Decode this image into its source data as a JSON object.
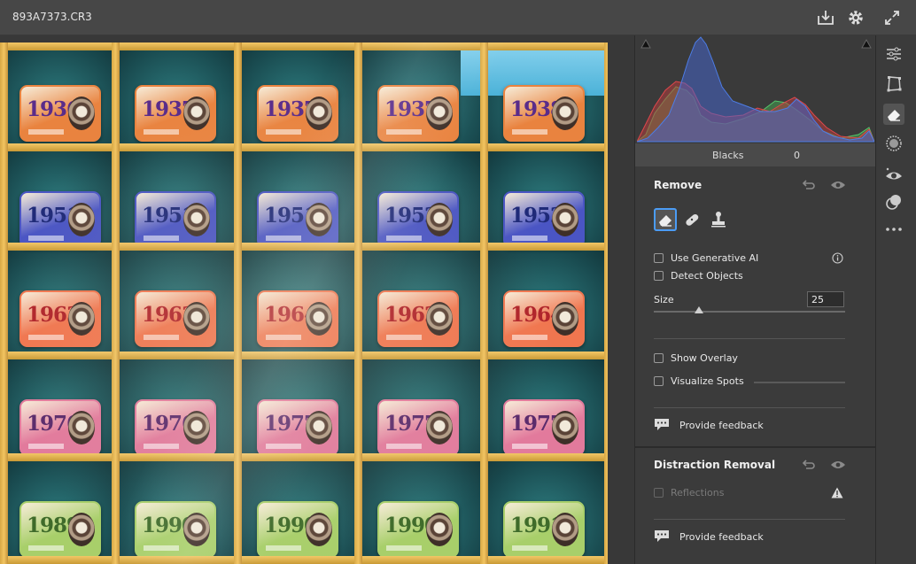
{
  "header": {
    "filename": "893A7373.CR3",
    "icons": [
      "save-icon",
      "gear-icon",
      "expand-icon"
    ]
  },
  "photo": {
    "rows": [
      {
        "years": [
          "1936",
          "1937",
          "1937",
          "1937",
          "1938"
        ],
        "tint": "#e9833f",
        "ink": "#5a2c8a"
      },
      {
        "years": [
          "1951",
          "1951",
          "1951",
          "1952",
          "1952"
        ],
        "tint": "#4a55c4",
        "ink": "#1f2a78"
      },
      {
        "years": [
          "1963",
          "1963",
          "1964",
          "1962",
          "1964"
        ],
        "tint": "#f0764f",
        "ink": "#b0242a"
      },
      {
        "years": [
          "1976",
          "1976",
          "1977",
          "1977",
          "1977"
        ],
        "tint": "#e27a9c",
        "ink": "#5b2b6c"
      },
      {
        "years": [
          "1989",
          "1990",
          "1990",
          "1990",
          "1991"
        ],
        "tint": "#a8cf6a",
        "ink": "#3f6b2a"
      }
    ]
  },
  "histogram": {
    "readout_label": "Blacks",
    "readout_value": "0",
    "colors": {
      "red": "#e0474c",
      "green": "#54c86a",
      "blue": "#4d7de6"
    }
  },
  "remove": {
    "title": "Remove",
    "tools": [
      "eraser-icon",
      "bandage-icon",
      "stamp-icon"
    ],
    "use_generative_ai": "Use Generative AI",
    "detect_objects": "Detect Objects",
    "size_label": "Size",
    "size_value": "25",
    "show_overlay": "Show Overlay",
    "visualize_spots": "Visualize Spots",
    "feedback": "Provide feedback"
  },
  "distraction": {
    "title": "Distraction Removal",
    "reflections": "Reflections",
    "feedback": "Provide feedback"
  },
  "rail": {
    "items": [
      "sliders-icon",
      "crop-icon",
      "eraser-icon",
      "masking-icon",
      "redeye-icon",
      "presets-icon",
      "more-icon"
    ],
    "active": "eraser-icon"
  },
  "accent": "#4b9cf5"
}
